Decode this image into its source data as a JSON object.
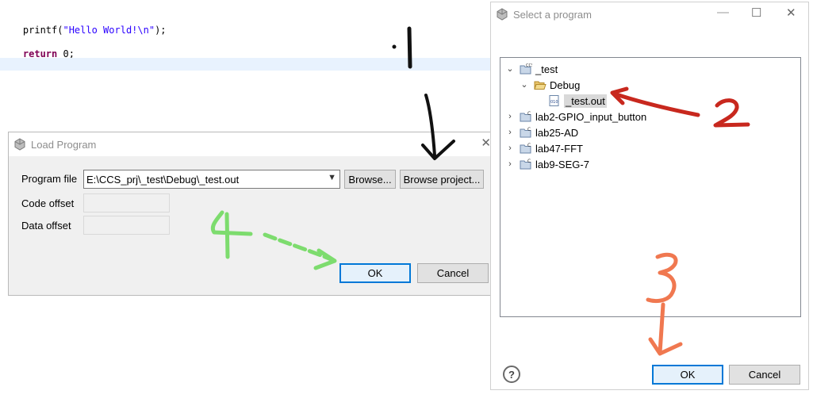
{
  "editor": {
    "lines": [
      {
        "prefix": "printf(",
        "string": "\"Hello World!\\n\"",
        "suffix": ");"
      },
      {
        "keyword": "return",
        "rest": " 0;"
      }
    ]
  },
  "load_program": {
    "title": "Load Program",
    "program_file_label": "Program file",
    "program_file_value": "E:\\CCS_prj\\_test\\Debug\\_test.out",
    "browse_label": "Browse...",
    "browse_project_label": "Browse project...",
    "code_offset_label": "Code offset",
    "data_offset_label": "Data offset",
    "ok_label": "OK",
    "cancel_label": "Cancel"
  },
  "select_program": {
    "title": "Select a program",
    "tree": [
      {
        "label": "_test",
        "expanded": true
      },
      {
        "label": "Debug",
        "expanded": true
      },
      {
        "label": "_test.out",
        "selected": true
      },
      {
        "label": "lab2-GPIO_input_button"
      },
      {
        "label": "lab25-AD"
      },
      {
        "label": "lab47-FFT"
      },
      {
        "label": "lab9-SEG-7"
      }
    ],
    "help_icon": "?",
    "ok_label": "OK",
    "cancel_label": "Cancel"
  },
  "annotations": {
    "step1": "·1",
    "step2": "2",
    "step3": "3",
    "step4": "4"
  },
  "colors": {
    "primary_border": "#0078d7",
    "annotation_black": "#111111",
    "annotation_red": "#c8281e",
    "annotation_orange": "#f07850",
    "annotation_green": "#7ddc6e"
  }
}
